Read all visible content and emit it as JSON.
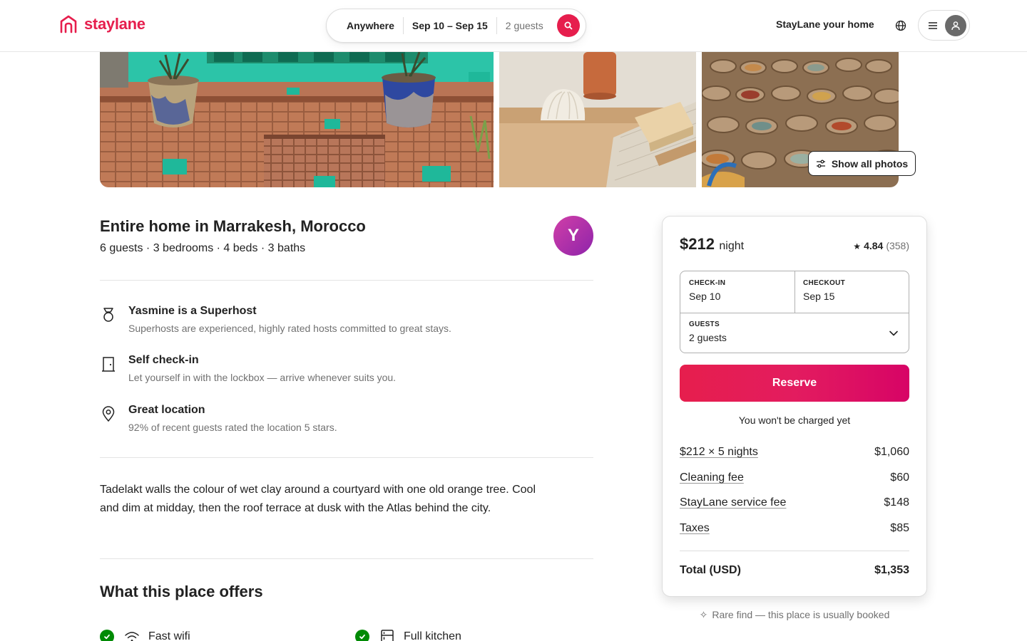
{
  "header": {
    "brand": "staylane",
    "search": {
      "location": "Anywhere",
      "dates": "Sep 10 – Sep 15",
      "guests": "2 guests"
    },
    "host_link": "StayLane your home"
  },
  "photos": {
    "show_all_label": "Show all photos"
  },
  "listing": {
    "title": "Entire home in Marrakesh, Morocco",
    "subtitle": "6 guests · 3 bedrooms · 4 beds · 3 baths",
    "host_initial": "Y",
    "highlights": [
      {
        "icon": "medal-icon",
        "title": "Yasmine is a Superhost",
        "desc": "Superhosts are experienced, highly rated hosts committed to great stays."
      },
      {
        "icon": "door-icon",
        "title": "Self check-in",
        "desc": "Let yourself in with the lockbox — arrive whenever suits you."
      },
      {
        "icon": "location-pin-icon",
        "title": "Great location",
        "desc": "92% of recent guests rated the location 5 stars."
      }
    ],
    "description": "Tadelakt walls the colour of wet clay around a courtyard with one old orange tree. Cool and dim at midday, then the roof terrace at dusk with the Atlas behind the city.",
    "offers_title": "What this place offers",
    "amenities": [
      {
        "icon": "wifi-icon",
        "label": "Fast wifi"
      },
      {
        "icon": "kitchen-icon",
        "label": "Full kitchen"
      }
    ]
  },
  "booking": {
    "price": "$212",
    "price_unit": "night",
    "rating": "4.84",
    "reviews": "(358)",
    "checkin_label": "CHECK-IN",
    "checkin_value": "Sep 10",
    "checkout_label": "CHECKOUT",
    "checkout_value": "Sep 15",
    "guests_label": "GUESTS",
    "guests_value": "2 guests",
    "reserve_label": "Reserve",
    "no_charge": "You won't be charged yet",
    "fees": [
      {
        "label": "$212 × 5 nights",
        "amount": "$1,060"
      },
      {
        "label": "Cleaning fee",
        "amount": "$60"
      },
      {
        "label": "StayLane service fee",
        "amount": "$148"
      },
      {
        "label": "Taxes",
        "amount": "$85"
      }
    ],
    "total_label": "Total (USD)",
    "total_amount": "$1,353",
    "rare_find": "Rare find — this place is usually booked"
  },
  "colors": {
    "brand": "#e61e4d",
    "superhost_check": "#008a05",
    "host_avatar": "#b03ab4"
  }
}
